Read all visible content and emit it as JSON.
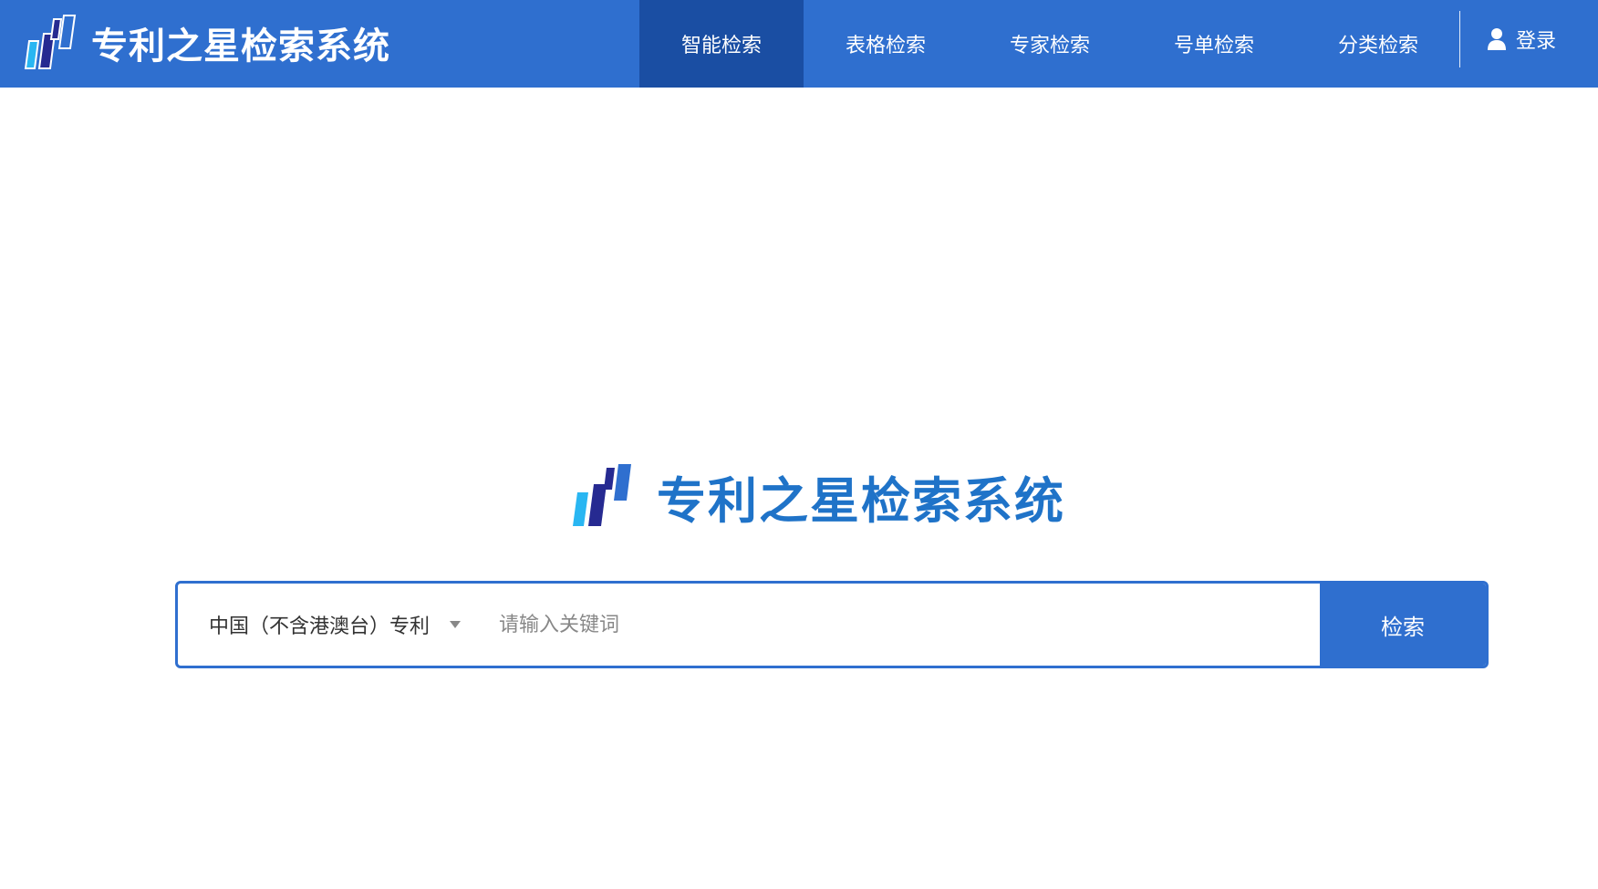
{
  "brand": {
    "title": "专利之星检索系统"
  },
  "nav": {
    "items": [
      {
        "label": "智能检索",
        "active": true
      },
      {
        "label": "表格检索",
        "active": false
      },
      {
        "label": "专家检索",
        "active": false
      },
      {
        "label": "号单检索",
        "active": false
      },
      {
        "label": "分类检索",
        "active": false
      }
    ],
    "login_label": "登录",
    "login_icon": "user-icon"
  },
  "center_brand": {
    "title": "专利之星检索系统"
  },
  "search": {
    "database_selected": "中国（不含港澳台）专利",
    "placeholder": "请输入关键词",
    "button_label": "检索"
  },
  "colors": {
    "header_bg": "#2f6fcf",
    "nav_active_bg": "#1a4ea3",
    "brand_text": "#1f73c8",
    "logo_light": "#29b6f2",
    "logo_dark": "#262a91"
  }
}
